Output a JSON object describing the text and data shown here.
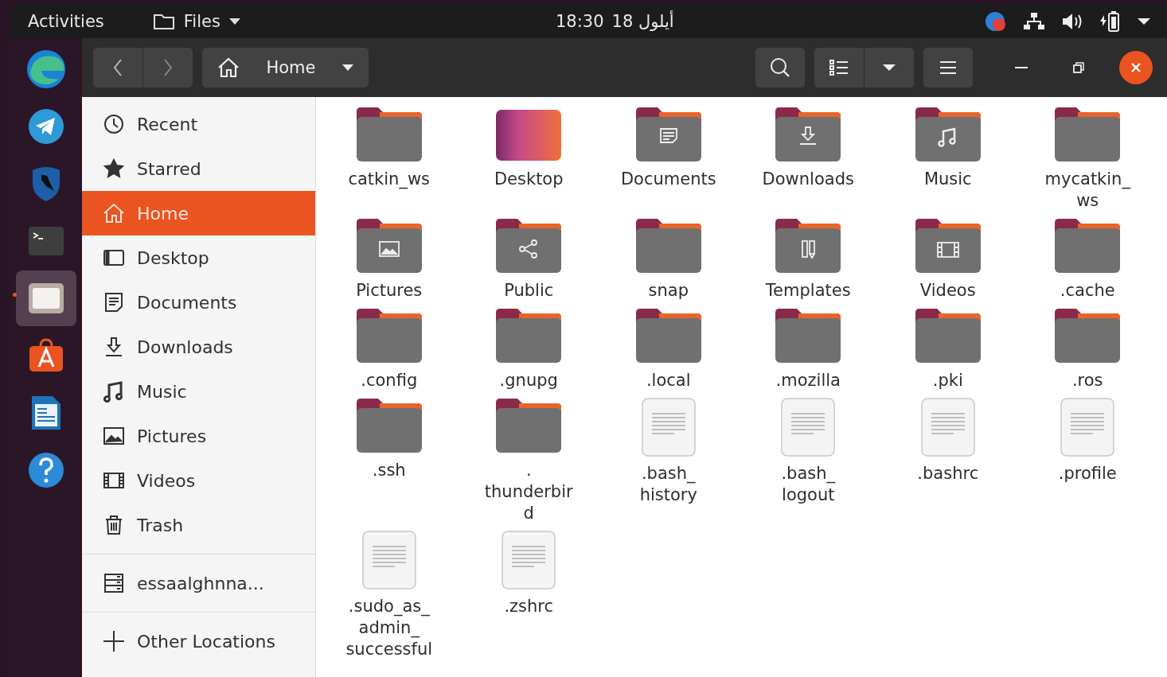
{
  "top_bar": {
    "activities": "Activities",
    "app_menu": "Files",
    "time": "18:30",
    "date": "18 أيلول"
  },
  "dock": [
    {
      "kind": "browser",
      "selected": false
    },
    {
      "kind": "telegram",
      "selected": false
    },
    {
      "kind": "shield",
      "selected": false
    },
    {
      "kind": "terminal",
      "selected": false
    },
    {
      "kind": "files",
      "selected": true
    },
    {
      "kind": "software",
      "selected": false
    },
    {
      "kind": "writer",
      "selected": false
    },
    {
      "kind": "help",
      "selected": false
    }
  ],
  "header": {
    "location": "Home"
  },
  "sidebar": {
    "items": [
      {
        "label": "Recent",
        "kind": "recent",
        "selected": false
      },
      {
        "label": "Starred",
        "kind": "starred",
        "selected": false
      },
      {
        "label": "Home",
        "kind": "home",
        "selected": true
      },
      {
        "label": "Desktop",
        "kind": "desktop",
        "selected": false
      },
      {
        "label": "Documents",
        "kind": "documents",
        "selected": false
      },
      {
        "label": "Downloads",
        "kind": "downloads",
        "selected": false
      },
      {
        "label": "Music",
        "kind": "music",
        "selected": false
      },
      {
        "label": "Pictures",
        "kind": "pictures",
        "selected": false
      },
      {
        "label": "Videos",
        "kind": "videos",
        "selected": false
      },
      {
        "label": "Trash",
        "kind": "trash",
        "selected": false
      }
    ],
    "devices": [
      {
        "label": "essaalghnna...",
        "kind": "drive",
        "selected": false
      }
    ],
    "other": [
      {
        "label": "Other Locations",
        "kind": "other",
        "selected": false
      }
    ]
  },
  "files": [
    {
      "name": "catkin_ws",
      "kind": "folder"
    },
    {
      "name": "Desktop",
      "kind": "desktop"
    },
    {
      "name": "Documents",
      "kind": "documents"
    },
    {
      "name": "Downloads",
      "kind": "downloads"
    },
    {
      "name": "Music",
      "kind": "music"
    },
    {
      "name": "mycatkin_\nws",
      "kind": "folder"
    },
    {
      "name": "Pictures",
      "kind": "pictures"
    },
    {
      "name": "Public",
      "kind": "public"
    },
    {
      "name": "snap",
      "kind": "folder"
    },
    {
      "name": "Templates",
      "kind": "templates"
    },
    {
      "name": "Videos",
      "kind": "videos"
    },
    {
      "name": ".cache",
      "kind": "folder"
    },
    {
      "name": ".config",
      "kind": "folder"
    },
    {
      "name": ".gnupg",
      "kind": "folder"
    },
    {
      "name": ".local",
      "kind": "folder"
    },
    {
      "name": ".mozilla",
      "kind": "folder"
    },
    {
      "name": ".pki",
      "kind": "folder"
    },
    {
      "name": ".ros",
      "kind": "folder"
    },
    {
      "name": ".ssh",
      "kind": "folder"
    },
    {
      "name": ".\nthunderbir\nd",
      "kind": "folder"
    },
    {
      "name": ".bash_\nhistory",
      "kind": "file"
    },
    {
      "name": ".bash_\nlogout",
      "kind": "file"
    },
    {
      "name": ".bashrc",
      "kind": "file"
    },
    {
      "name": ".profile",
      "kind": "file"
    },
    {
      "name": ".sudo_as_\nadmin_\nsuccessful",
      "kind": "file"
    },
    {
      "name": ".zshrc",
      "kind": "file"
    }
  ]
}
